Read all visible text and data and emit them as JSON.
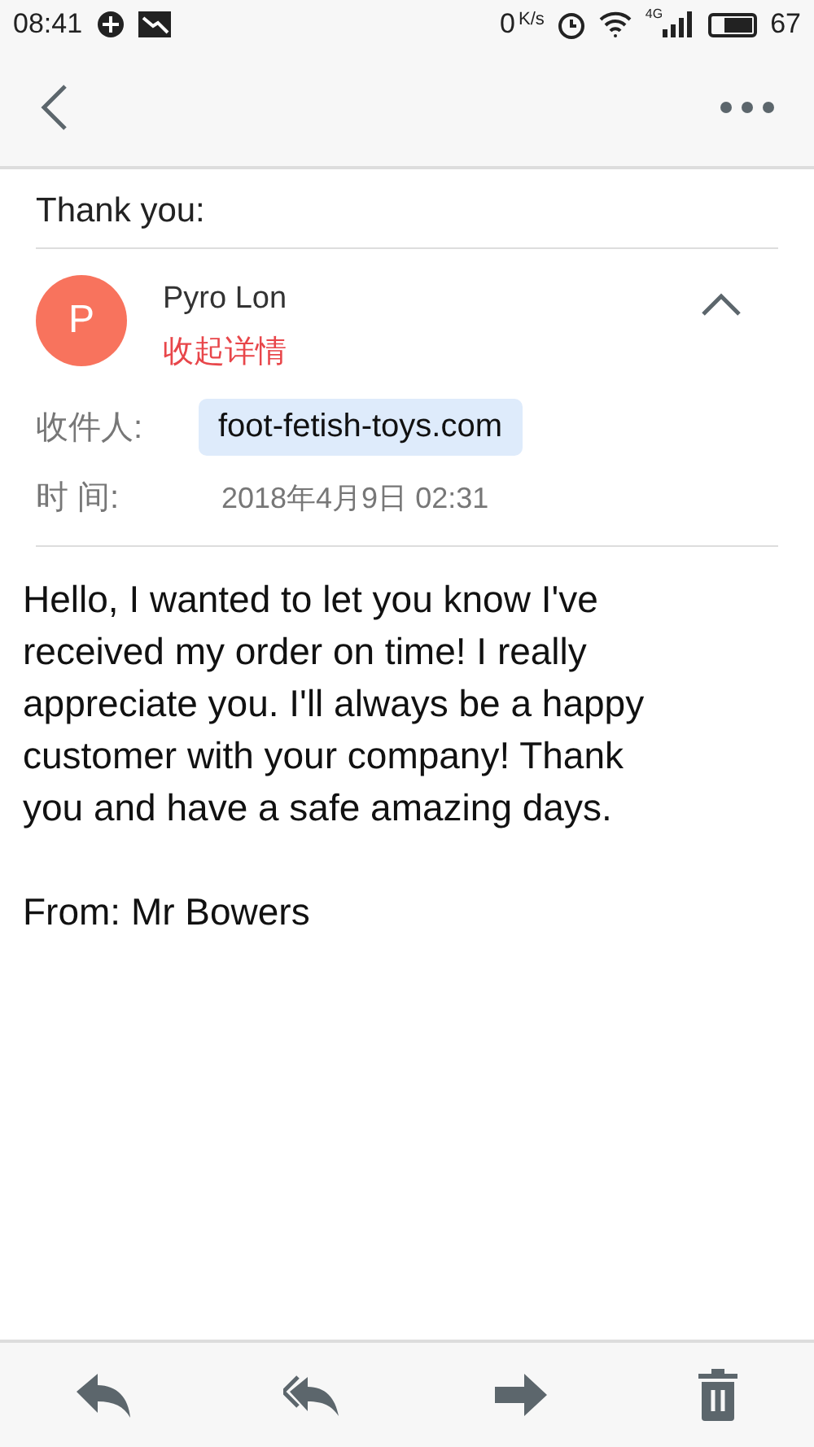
{
  "status_bar": {
    "time": "08:41",
    "net_speed": "0",
    "net_unit": "K/s",
    "network": "4G",
    "battery": "67"
  },
  "subject": "Thank you:",
  "sender": {
    "initial": "P",
    "name": "Pyro Lon",
    "toggle": "收起详情",
    "expanded": true
  },
  "details": [
    {
      "label": "收件人:",
      "value": "foot-fetish-toys.com",
      "kind": "chip"
    },
    {
      "label": "时 间:",
      "value": "2018年4月9日 02:31",
      "kind": "text"
    }
  ],
  "body": [
    "Hello, I wanted to let you know I've received my order on time! I really appreciate you. I'll always be a happy customer with your company! Thank you and have a safe amazing days.",
    "From: Mr Bowers"
  ]
}
